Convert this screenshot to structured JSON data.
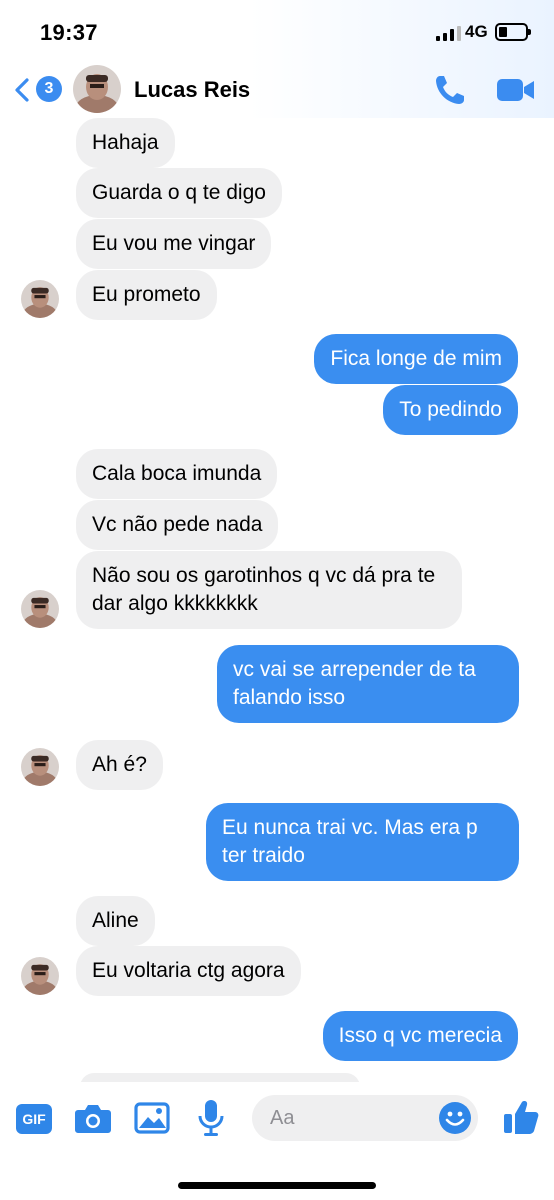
{
  "status": {
    "time": "19:37",
    "network": "4G"
  },
  "header": {
    "back_count": "3",
    "contact_name": "Lucas Reis",
    "icons": {
      "back": "chevron-left-icon",
      "call": "phone-icon",
      "video": "video-camera-icon"
    }
  },
  "colors": {
    "accent": "#3a8ef0",
    "incoming_bubble": "#efeff0",
    "outgoing_bubble": "#3a8ef0"
  },
  "messages": [
    {
      "from": "contact",
      "text": "Hahaja"
    },
    {
      "from": "contact",
      "text": "Guarda o q te digo"
    },
    {
      "from": "contact",
      "text": "Eu vou me vingar"
    },
    {
      "from": "contact",
      "text": "Eu prometo"
    },
    {
      "from": "me",
      "text": "Fica longe de mim"
    },
    {
      "from": "me",
      "text": "To pedindo"
    },
    {
      "from": "contact",
      "text": "Cala boca imunda"
    },
    {
      "from": "contact",
      "text": "Vc não pede nada"
    },
    {
      "from": "contact",
      "text": "Não sou os garotinhos q vc dá pra te dar algo kkkkkkkk"
    },
    {
      "from": "me",
      "text": "vc vai se arrepender de ta falando isso"
    },
    {
      "from": "contact",
      "text": "Ah é?"
    },
    {
      "from": "me",
      "text": "Eu nunca trai vc. Mas era p ter traido"
    },
    {
      "from": "contact",
      "text": "Aline"
    },
    {
      "from": "contact",
      "text": "Eu voltaria ctg agora"
    },
    {
      "from": "me",
      "text": "Isso q vc merecia"
    }
  ],
  "composer": {
    "gif_label": "GIF",
    "placeholder": "Aa",
    "icons": [
      "camera-icon",
      "image-icon",
      "microphone-icon",
      "emoji-icon",
      "thumbs-up-icon"
    ]
  }
}
